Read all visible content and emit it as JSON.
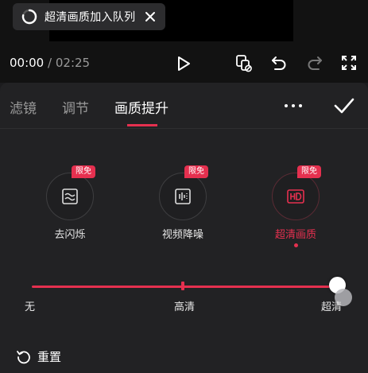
{
  "toast": {
    "text": "超清画质加入队列",
    "icons": [
      "spinner-icon",
      "close-icon"
    ]
  },
  "player": {
    "current_time": "00:00",
    "separator": "/",
    "total_time": "02:25",
    "icons": [
      "play-icon",
      "device-icon",
      "undo-icon",
      "redo-icon",
      "fullscreen-icon"
    ]
  },
  "tabs": [
    {
      "label": "滤镜",
      "active": false
    },
    {
      "label": "调节",
      "active": false
    },
    {
      "label": "画质提升",
      "active": true
    }
  ],
  "header_icons": [
    "more-icon",
    "confirm-icon"
  ],
  "options": [
    {
      "label": "去闪烁",
      "badge": "限免",
      "icon": "wave-icon",
      "selected": false
    },
    {
      "label": "视频降噪",
      "badge": "限免",
      "icon": "denoise-icon",
      "selected": false
    },
    {
      "label": "超清画质",
      "badge": "限免",
      "icon": "hd-icon",
      "selected": true
    }
  ],
  "slider": {
    "labels": [
      "无",
      "高清",
      "超清"
    ],
    "value_fraction": 1.0
  },
  "reset": {
    "label": "重置",
    "icon": "reset-icon"
  },
  "colors": {
    "accent": "#e5304f",
    "panel_bg": "#222224",
    "top_bg": "#121212"
  }
}
